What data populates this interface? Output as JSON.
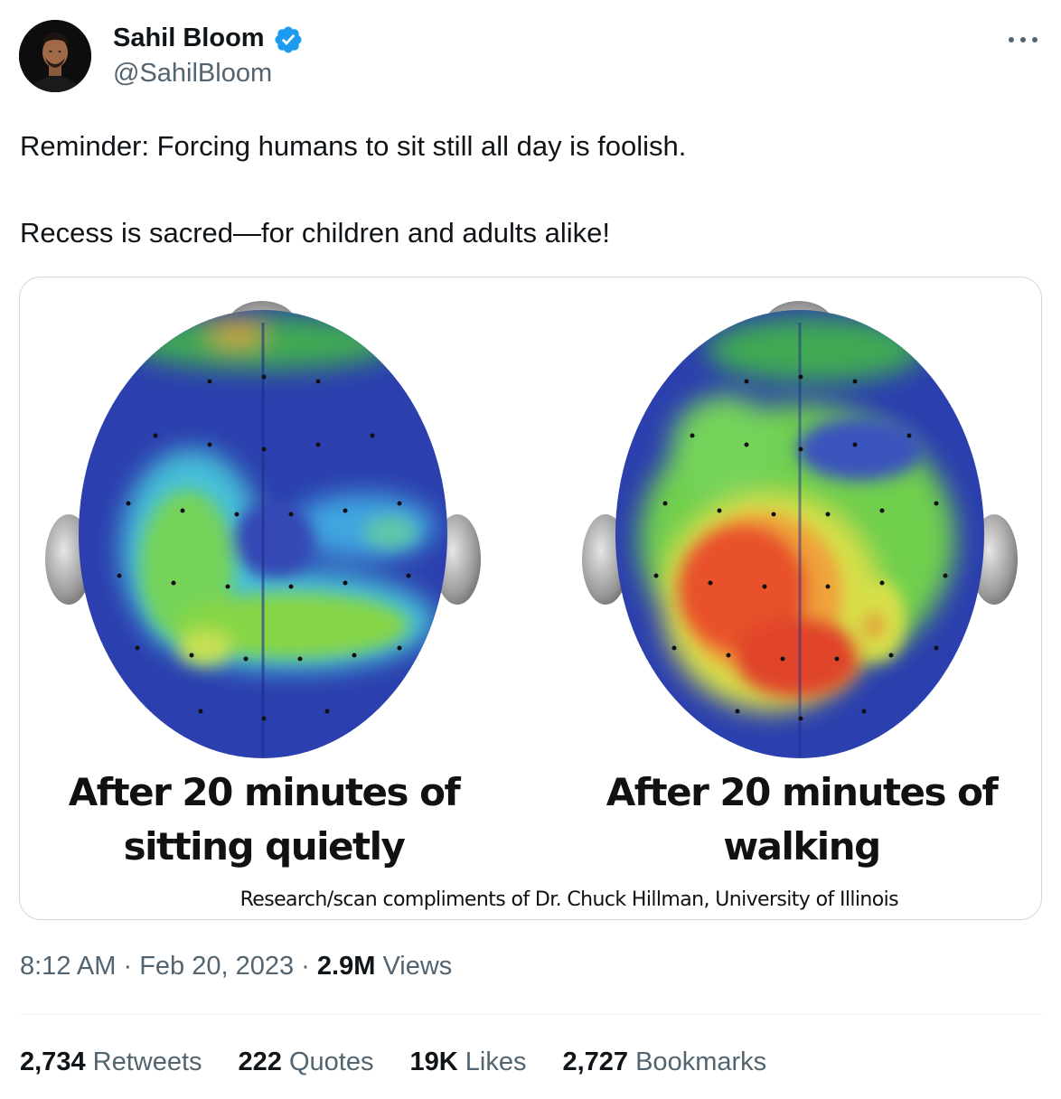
{
  "author": {
    "name": "Sahil Bloom",
    "handle": "@SahilBloom",
    "verified": true,
    "avatar_icon": "profile-photo"
  },
  "more_icon": "more-horizontal-icon",
  "text": {
    "line1": "Reminder: Forcing humans to sit still all day is foolish.",
    "line2": "Recess is sacred—for children and adults alike!"
  },
  "media": {
    "caption_left_line1": "After 20 minutes of",
    "caption_left_line2": "sitting quietly",
    "caption_right_line1": "After 20 minutes of",
    "caption_right_line2": "walking",
    "credit": "Research/scan compliments of Dr. Chuck Hillman, University of Illinois"
  },
  "meta": {
    "time": "8:12 AM",
    "separator": " · ",
    "date": "Feb 20, 2023",
    "views_count": "2.9M",
    "views_label": "Views"
  },
  "stats": [
    {
      "count": "2,734",
      "label": "Retweets"
    },
    {
      "count": "222",
      "label": "Quotes"
    },
    {
      "count": "19K",
      "label": "Likes"
    },
    {
      "count": "2,727",
      "label": "Bookmarks"
    }
  ],
  "colors": {
    "verified_blue": "#1d9bf0",
    "text_primary": "#0f1419",
    "text_secondary": "#536471",
    "border": "#cfd9de"
  }
}
